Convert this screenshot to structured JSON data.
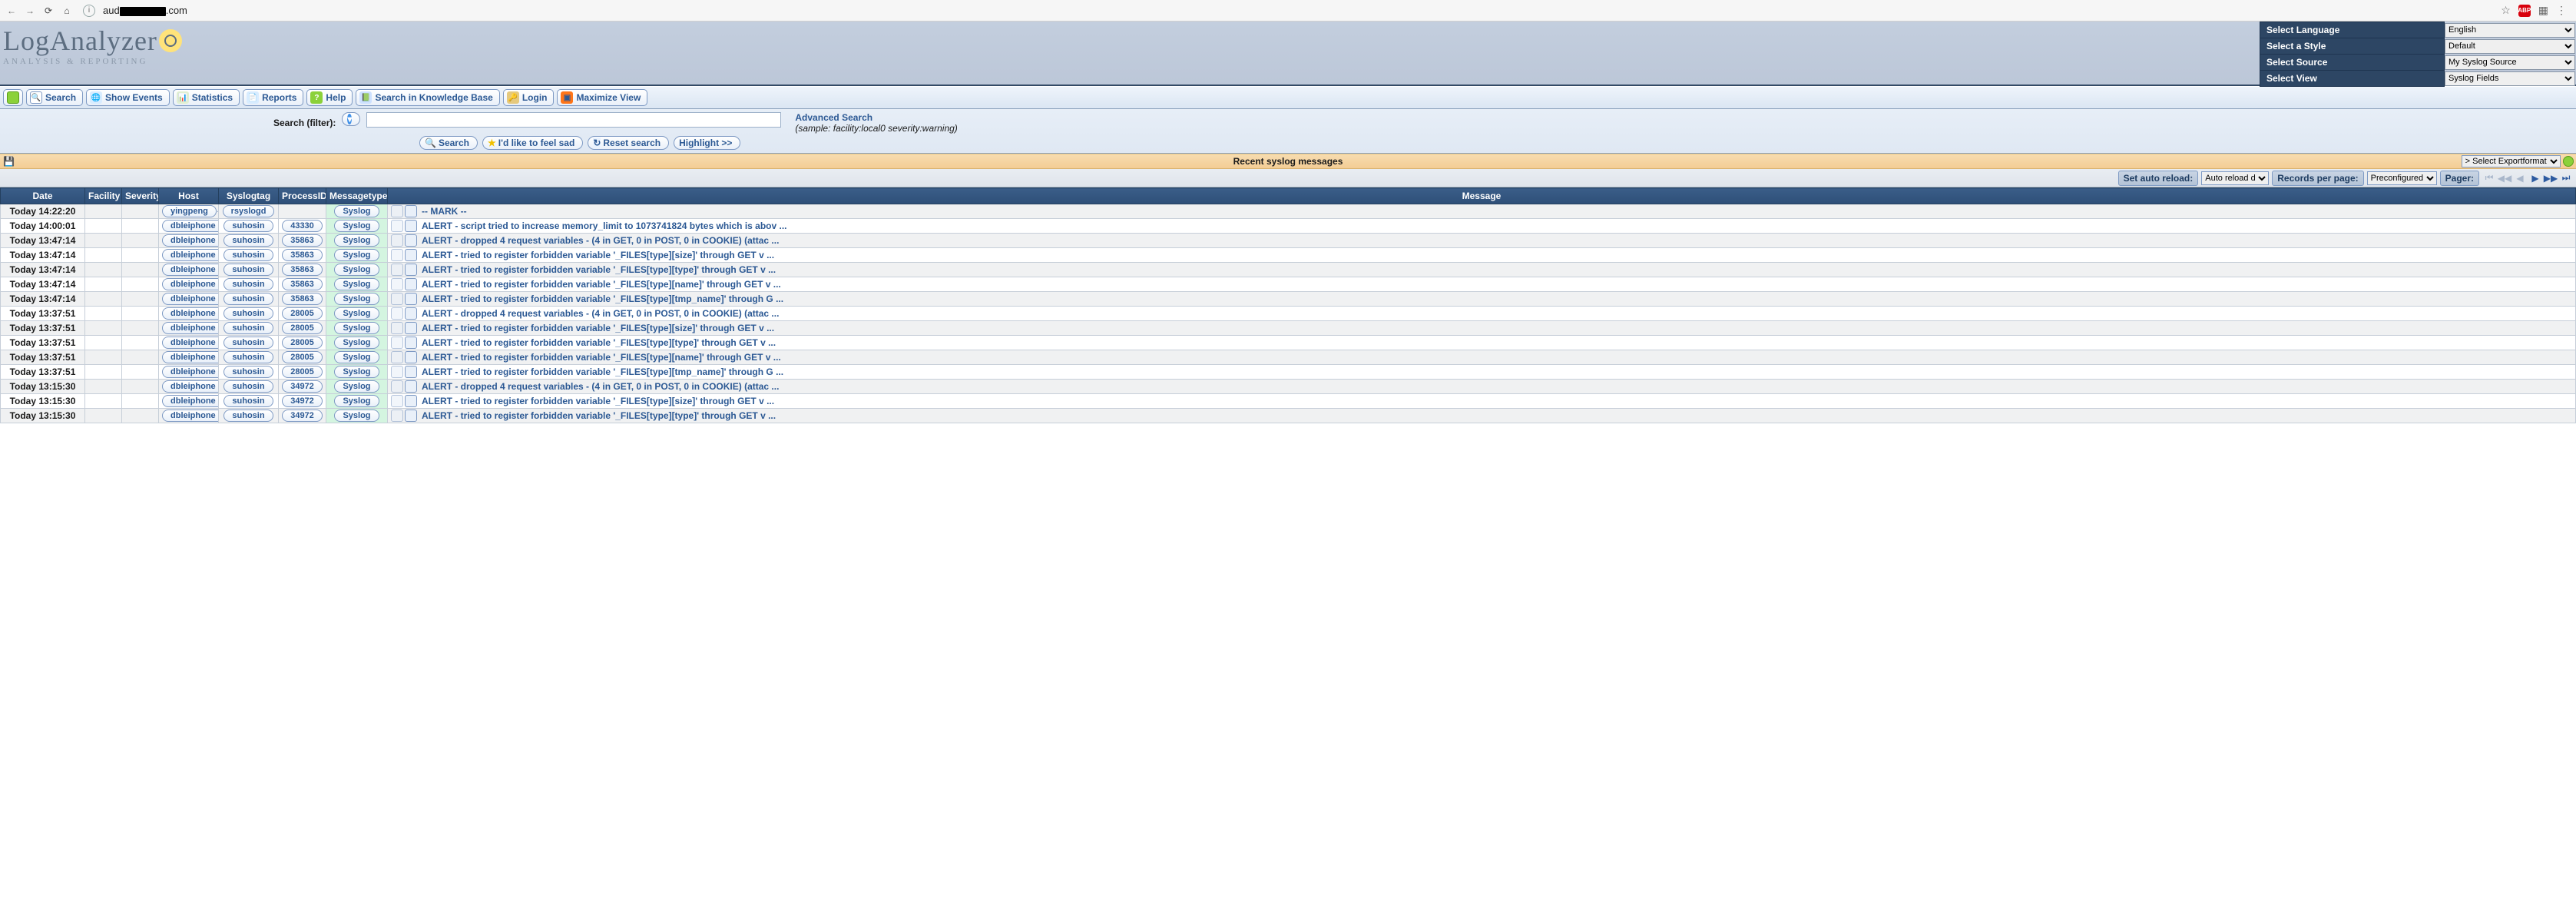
{
  "browser": {
    "back": "←",
    "fwd": "→",
    "reload": "⟳",
    "home": "⌂",
    "url_pre": "aud",
    "url_post": ".com",
    "star": "☆",
    "abp": "ABP",
    "pic": "▦",
    "menu": "⋮"
  },
  "brand": {
    "name": "LogAnalyzer",
    "tagline": "ANALYSIS & REPORTING"
  },
  "header_selects": [
    {
      "label": "Select Language",
      "value": "English"
    },
    {
      "label": "Select a Style",
      "value": "Default"
    },
    {
      "label": "Select Source",
      "value": "My Syslog Source"
    },
    {
      "label": "Select View",
      "value": "Syslog Fields"
    }
  ],
  "toolbar": {
    "search": "Search",
    "show_events": "Show Events",
    "statistics": "Statistics",
    "reports": "Reports",
    "help": "Help",
    "kb": "Search in Knowledge Base",
    "login": "Login",
    "maximize": "Maximize View"
  },
  "search_panel": {
    "label": "Search (filter):",
    "btn_search": "Search",
    "btn_feel": "I'd like to feel sad",
    "btn_reset": "Reset search",
    "btn_highlight": "Highlight >>",
    "advanced": "Advanced Search",
    "sample": "(sample: facility:local0 severity:warning)",
    "filter_value": ""
  },
  "orange_title": "Recent syslog messages",
  "export_select": "> Select Exportformat",
  "controls": {
    "auto_label": "Set auto reload:",
    "auto_value": "Auto reload d",
    "records_label": "Records per page:",
    "records_value": "Preconfigured",
    "pager_label": "Pager:"
  },
  "columns": [
    "Date",
    "Facility",
    "Severity",
    "Host",
    "Syslogtag",
    "ProcessID",
    "Messagetype",
    "Message"
  ],
  "rows": [
    {
      "date": "Today 14:22:20",
      "host": "yingpeng",
      "tag": "rsyslogd",
      "pid": "",
      "mtype": "Syslog",
      "msg": "-- MARK --"
    },
    {
      "date": "Today 14:00:01",
      "host": "dbleiphone",
      "tag": "suhosin",
      "pid": "43330",
      "mtype": "Syslog",
      "msg": "ALERT - script tried to increase memory_limit to 1073741824 bytes which is abov ..."
    },
    {
      "date": "Today 13:47:14",
      "host": "dbleiphone",
      "tag": "suhosin",
      "pid": "35863",
      "mtype": "Syslog",
      "msg": "ALERT - dropped 4 request variables - (4 in GET, 0 in POST, 0 in COOKIE) (attac ..."
    },
    {
      "date": "Today 13:47:14",
      "host": "dbleiphone",
      "tag": "suhosin",
      "pid": "35863",
      "mtype": "Syslog",
      "msg": "ALERT - tried to register forbidden variable '_FILES[type][size]' through GET v ..."
    },
    {
      "date": "Today 13:47:14",
      "host": "dbleiphone",
      "tag": "suhosin",
      "pid": "35863",
      "mtype": "Syslog",
      "msg": "ALERT - tried to register forbidden variable '_FILES[type][type]' through GET v ..."
    },
    {
      "date": "Today 13:47:14",
      "host": "dbleiphone",
      "tag": "suhosin",
      "pid": "35863",
      "mtype": "Syslog",
      "msg": "ALERT - tried to register forbidden variable '_FILES[type][name]' through GET v ..."
    },
    {
      "date": "Today 13:47:14",
      "host": "dbleiphone",
      "tag": "suhosin",
      "pid": "35863",
      "mtype": "Syslog",
      "msg": "ALERT - tried to register forbidden variable '_FILES[type][tmp_name]' through G ..."
    },
    {
      "date": "Today 13:37:51",
      "host": "dbleiphone",
      "tag": "suhosin",
      "pid": "28005",
      "mtype": "Syslog",
      "msg": "ALERT - dropped 4 request variables - (4 in GET, 0 in POST, 0 in COOKIE) (attac ..."
    },
    {
      "date": "Today 13:37:51",
      "host": "dbleiphone",
      "tag": "suhosin",
      "pid": "28005",
      "mtype": "Syslog",
      "msg": "ALERT - tried to register forbidden variable '_FILES[type][size]' through GET v ..."
    },
    {
      "date": "Today 13:37:51",
      "host": "dbleiphone",
      "tag": "suhosin",
      "pid": "28005",
      "mtype": "Syslog",
      "msg": "ALERT - tried to register forbidden variable '_FILES[type][type]' through GET v ..."
    },
    {
      "date": "Today 13:37:51",
      "host": "dbleiphone",
      "tag": "suhosin",
      "pid": "28005",
      "mtype": "Syslog",
      "msg": "ALERT - tried to register forbidden variable '_FILES[type][name]' through GET v ..."
    },
    {
      "date": "Today 13:37:51",
      "host": "dbleiphone",
      "tag": "suhosin",
      "pid": "28005",
      "mtype": "Syslog",
      "msg": "ALERT - tried to register forbidden variable '_FILES[type][tmp_name]' through G ..."
    },
    {
      "date": "Today 13:15:30",
      "host": "dbleiphone",
      "tag": "suhosin",
      "pid": "34972",
      "mtype": "Syslog",
      "msg": "ALERT - dropped 4 request variables - (4 in GET, 0 in POST, 0 in COOKIE) (attac ..."
    },
    {
      "date": "Today 13:15:30",
      "host": "dbleiphone",
      "tag": "suhosin",
      "pid": "34972",
      "mtype": "Syslog",
      "msg": "ALERT - tried to register forbidden variable '_FILES[type][size]' through GET v ..."
    },
    {
      "date": "Today 13:15:30",
      "host": "dbleiphone",
      "tag": "suhosin",
      "pid": "34972",
      "mtype": "Syslog",
      "msg": "ALERT - tried to register forbidden variable '_FILES[type][type]' through GET v ..."
    }
  ]
}
